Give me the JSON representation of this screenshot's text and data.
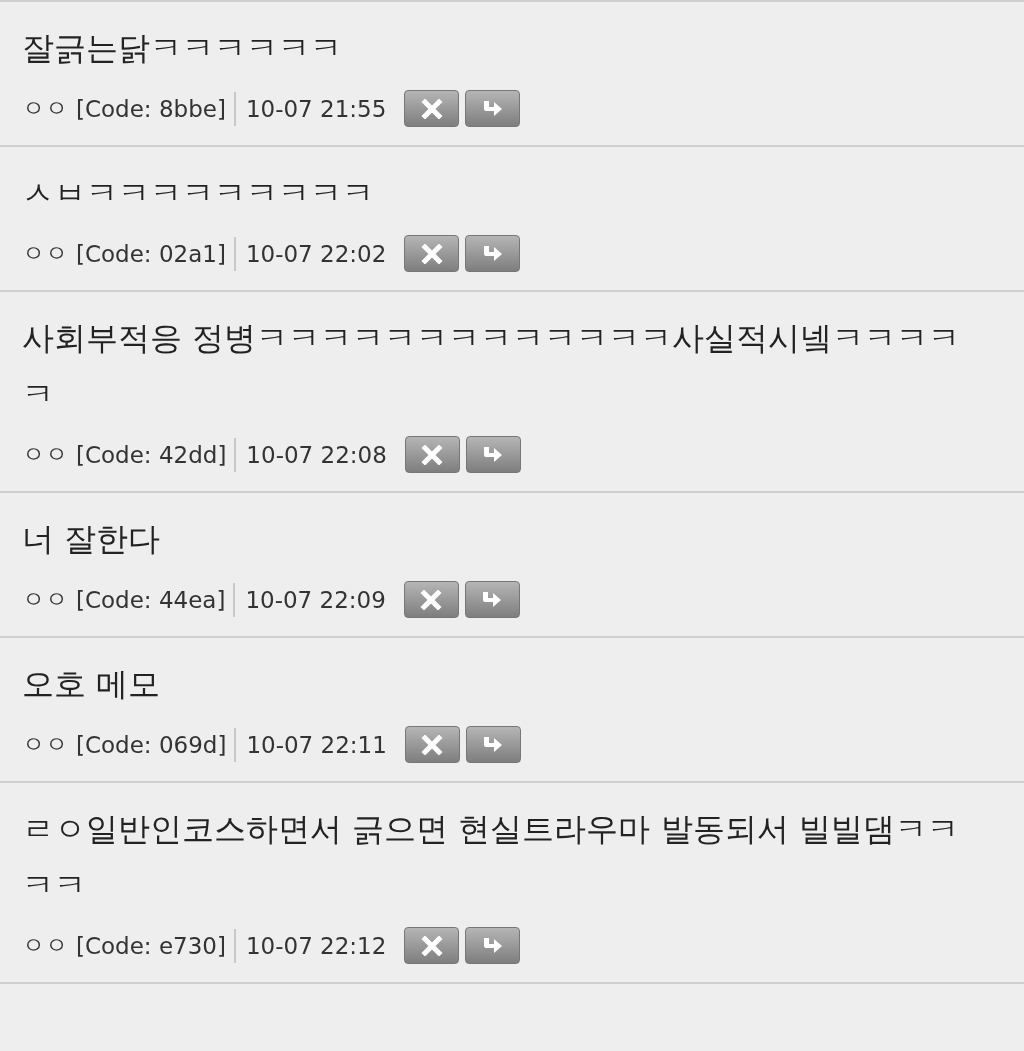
{
  "comments": [
    {
      "text": "잘긁는닭ㅋㅋㅋㅋㅋㅋ",
      "author": "ㅇㅇ",
      "code": "[Code: 8bbe]",
      "time": "10-07 21:55"
    },
    {
      "text": "ㅅㅂㅋㅋㅋㅋㅋㅋㅋㅋㅋ",
      "author": "ㅇㅇ",
      "code": "[Code: 02a1]",
      "time": "10-07 22:02"
    },
    {
      "text": "사회부적응 정병ㅋㅋㅋㅋㅋㅋㅋㅋㅋㅋㅋㅋㅋ사실적시넼ㅋㅋㅋㅋㅋ",
      "author": "ㅇㅇ",
      "code": "[Code: 42dd]",
      "time": "10-07 22:08"
    },
    {
      "text": "너 잘한다",
      "author": "ㅇㅇ",
      "code": "[Code: 44ea]",
      "time": "10-07 22:09"
    },
    {
      "text": "오호 메모",
      "author": "ㅇㅇ",
      "code": "[Code: 069d]",
      "time": "10-07 22:11"
    },
    {
      "text": "ㄹㅇ일반인코스하면서 긁으면 현실트라우마 발동되서 빌빌댐ㅋㅋㅋㅋ",
      "author": "ㅇㅇ",
      "code": "[Code: e730]",
      "time": "10-07 22:12"
    }
  ]
}
